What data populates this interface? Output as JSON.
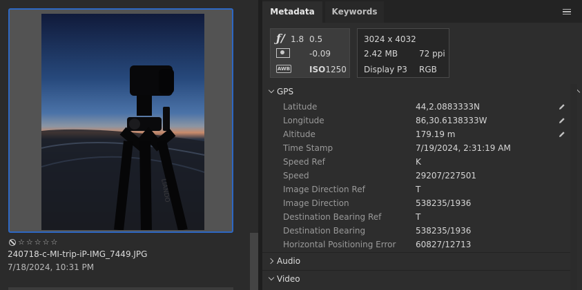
{
  "filmstrip": {
    "rating_stars": [
      "☆",
      "☆",
      "☆",
      "☆",
      "☆"
    ],
    "file_name": "240718-c-MI-trip-iP-IMG_7449.JPG",
    "file_date": "7/18/2024, 10:31 PM"
  },
  "panel": {
    "tabs": [
      "Metadata",
      "Keywords"
    ]
  },
  "summary": {
    "aperture_icon": "ƒ/",
    "aperture": "1.8",
    "shutter": "0.5",
    "exposure_comp": "-0.09",
    "wb_icon": "AWB",
    "iso_label": "ISO",
    "iso_value": "1250",
    "dimensions": "3024 x 4032",
    "file_size": "2.42 MB",
    "resolution": "72 ppi",
    "color_profile": "Display P3",
    "color_mode": "RGB"
  },
  "sections": {
    "gps": "GPS",
    "audio": "Audio",
    "video": "Video"
  },
  "gps_fields": [
    {
      "label": "Latitude",
      "value": "44,2.0883333N",
      "editable": true
    },
    {
      "label": "Longitude",
      "value": "86,30.6138333W",
      "editable": true
    },
    {
      "label": "Altitude",
      "value": "179.19 m",
      "editable": true
    },
    {
      "label": "Time Stamp",
      "value": "7/19/2024, 2:31:19 AM",
      "editable": false
    },
    {
      "label": "Speed Ref",
      "value": "K",
      "editable": false
    },
    {
      "label": "Speed",
      "value": "29207/227501",
      "editable": false
    },
    {
      "label": "Image Direction Ref",
      "value": "T",
      "editable": false
    },
    {
      "label": "Image Direction",
      "value": "538235/1936",
      "editable": false
    },
    {
      "label": "Destination Bearing Ref",
      "value": "T",
      "editable": false
    },
    {
      "label": "Destination Bearing",
      "value": "538235/1936",
      "editable": false
    },
    {
      "label": "Horizontal Positioning Error",
      "value": "60827/12713",
      "editable": false
    }
  ],
  "icons": {
    "pencil": "pencil-icon",
    "reject": "reject-icon",
    "menu": "panel-menu-icon"
  },
  "colors": {
    "selection": "#2d68c4",
    "panel_bg": "#2d2d2d",
    "tab_bar_bg": "#232323"
  }
}
